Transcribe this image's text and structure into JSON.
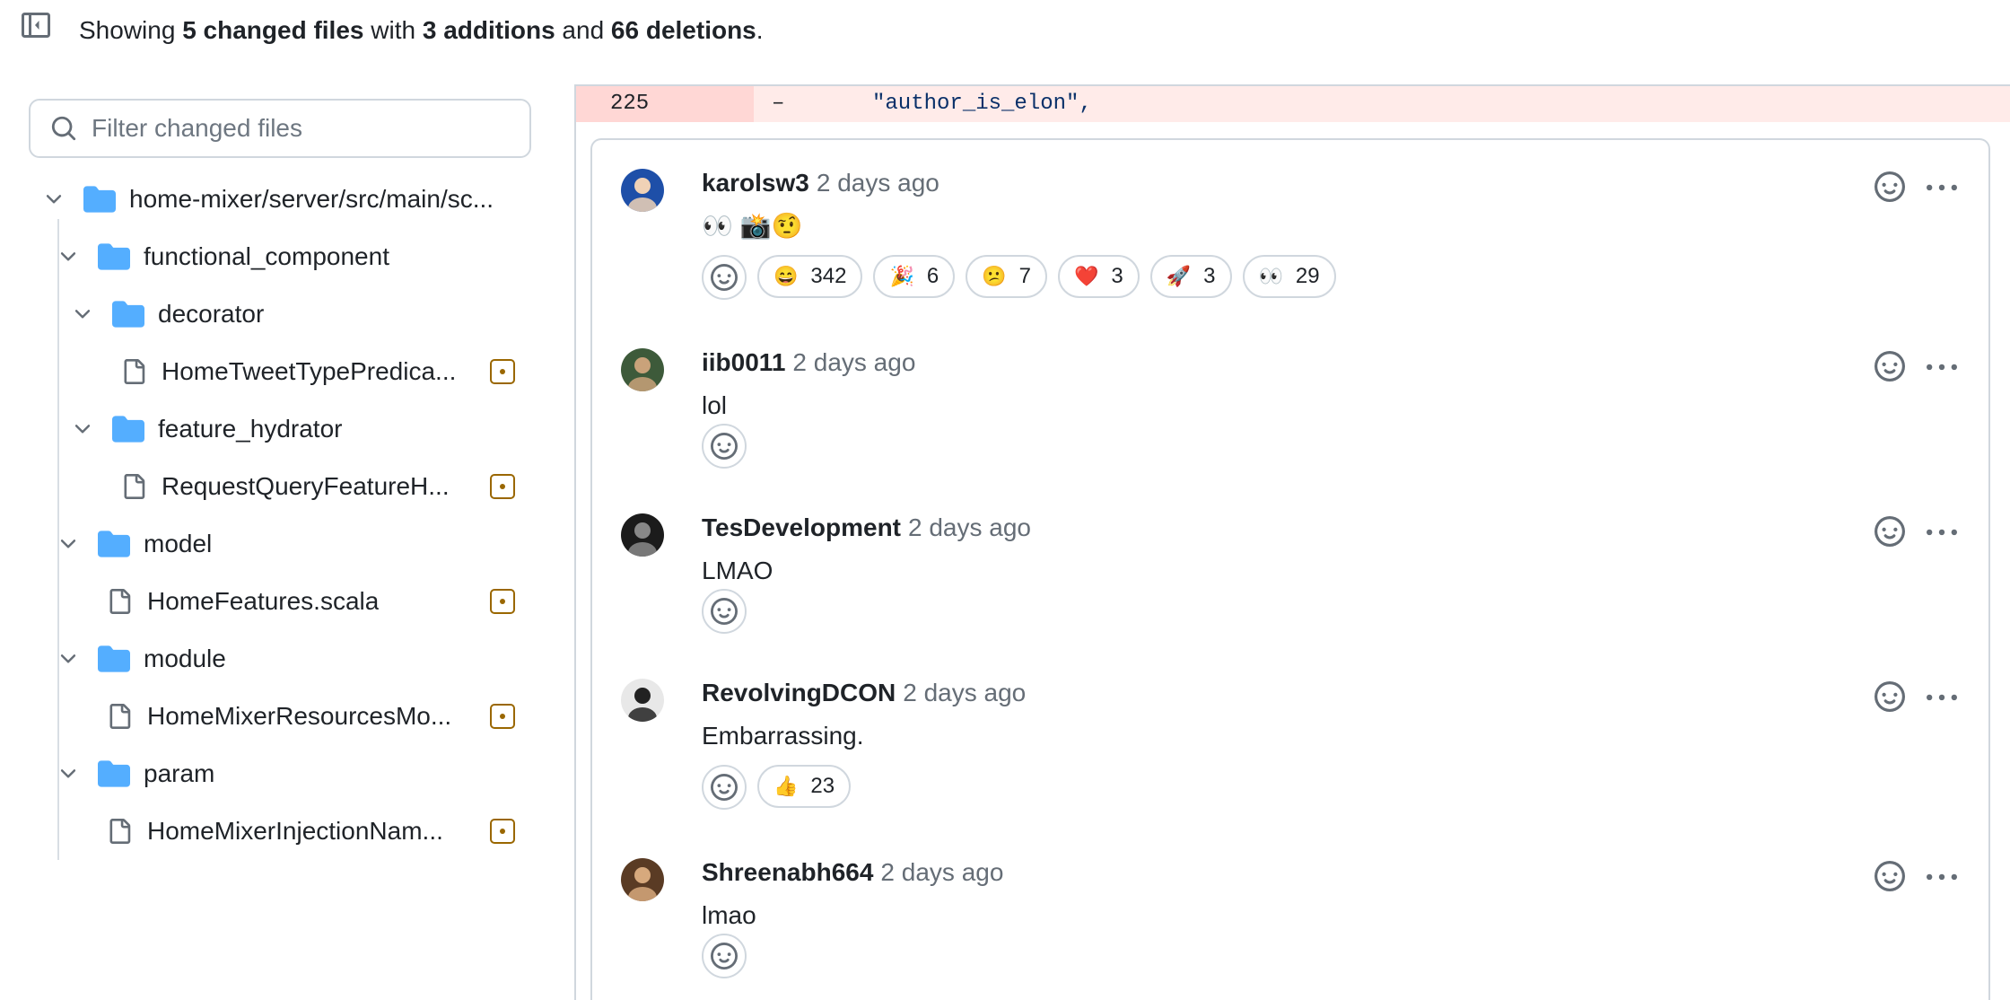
{
  "summary": {
    "prefix": "Showing",
    "files": "5 changed files",
    "with": "with",
    "additions": "3 additions",
    "and": "and",
    "deletions": "66 deletions",
    "period": "."
  },
  "filter": {
    "placeholder": "Filter changed files"
  },
  "tree": [
    {
      "type": "folder",
      "label": "home-mixer/server/src/main/sc..."
    },
    {
      "type": "folder",
      "label": "functional_component"
    },
    {
      "type": "folder",
      "label": "decorator"
    },
    {
      "type": "file",
      "label": "HomeTweetTypePredica..."
    },
    {
      "type": "folder",
      "label": "feature_hydrator"
    },
    {
      "type": "file",
      "label": "RequestQueryFeatureH..."
    },
    {
      "type": "folder",
      "label": "model"
    },
    {
      "type": "file",
      "label": "HomeFeatures.scala"
    },
    {
      "type": "folder",
      "label": "module"
    },
    {
      "type": "file",
      "label": "HomeMixerResourcesMo..."
    },
    {
      "type": "folder",
      "label": "param"
    },
    {
      "type": "file",
      "label": "HomeMixerInjectionNam..."
    }
  ],
  "diff": {
    "line": "225",
    "sign": "–",
    "code": "\"author_is_elon\","
  },
  "comments": [
    {
      "author": "karolsw3",
      "time": "2 days ago",
      "body": "👀 📸🤨",
      "reactions": [
        {
          "emoji": "😄",
          "count": "342"
        },
        {
          "emoji": "🎉",
          "count": "6"
        },
        {
          "emoji": "😕",
          "count": "7"
        },
        {
          "emoji": "❤️",
          "count": "3"
        },
        {
          "emoji": "🚀",
          "count": "3"
        },
        {
          "emoji": "👀",
          "count": "29"
        }
      ]
    },
    {
      "author": "iib0011",
      "time": "2 days ago",
      "body": "lol",
      "reactions": []
    },
    {
      "author": "TesDevelopment",
      "time": "2 days ago",
      "body": "LMAO",
      "reactions": []
    },
    {
      "author": "RevolvingDCON",
      "time": "2 days ago",
      "body": "Embarrassing.",
      "reactions": [
        {
          "emoji": "👍",
          "count": "23"
        }
      ]
    },
    {
      "author": "Shreenabh664",
      "time": "2 days ago",
      "body": "lmao",
      "reactions": []
    }
  ]
}
